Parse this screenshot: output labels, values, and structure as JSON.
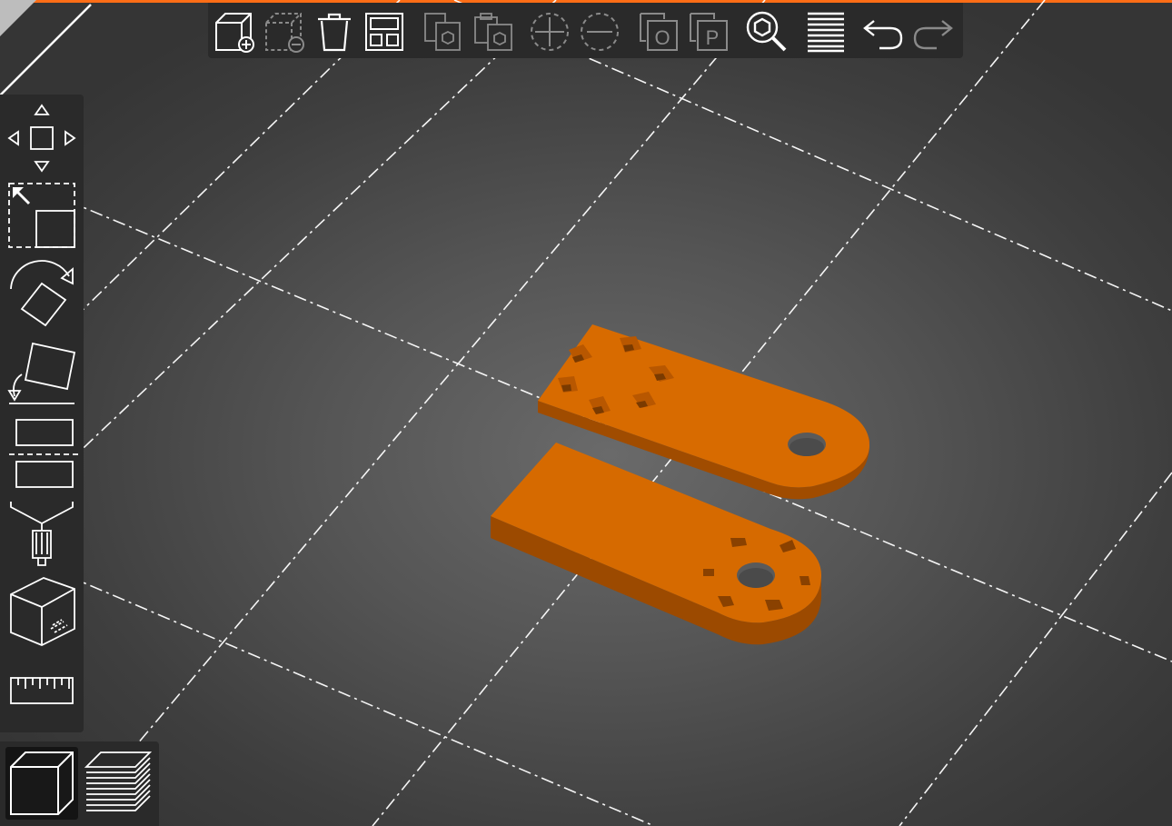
{
  "app": {
    "accent_color": "#fe6d16",
    "part_color": "#d66a00",
    "part_side_color": "#a84f00",
    "grid_line_color": "#ffffff",
    "toolbar_bg": "#2a2a2a",
    "icon_color": "#ffffff",
    "icon_disabled_color": "#8a8a8a"
  },
  "top_toolbar": {
    "buttons": [
      {
        "name": "add-object-icon",
        "enabled": true
      },
      {
        "name": "delete-object-icon",
        "enabled": false
      },
      {
        "name": "delete-all-icon",
        "enabled": true
      },
      {
        "name": "arrange-icon",
        "enabled": true
      },
      {
        "name": "copy-icon",
        "enabled": false
      },
      {
        "name": "paste-icon",
        "enabled": false
      },
      {
        "name": "add-instance-icon",
        "enabled": false
      },
      {
        "name": "remove-instance-icon",
        "enabled": false
      },
      {
        "name": "split-to-objects-icon",
        "enabled": false
      },
      {
        "name": "split-to-parts-icon",
        "enabled": false
      },
      {
        "name": "search-icon",
        "enabled": true
      },
      {
        "name": "layers-editing-icon",
        "enabled": true
      },
      {
        "name": "undo-icon",
        "enabled": true
      },
      {
        "name": "redo-icon",
        "enabled": false
      }
    ],
    "split_objects_letter": "O",
    "split_parts_letter": "P"
  },
  "left_toolbar": {
    "tools": [
      "move-icon",
      "scale-icon",
      "rotate-icon",
      "place-on-face-icon",
      "cut-icon",
      "paint-supports-icon",
      "seam-painting-icon",
      "measure-icon"
    ]
  },
  "view_switch": {
    "modes": [
      {
        "name": "3d-view-icon",
        "active": true
      },
      {
        "name": "preview-layers-icon",
        "active": false
      }
    ]
  }
}
